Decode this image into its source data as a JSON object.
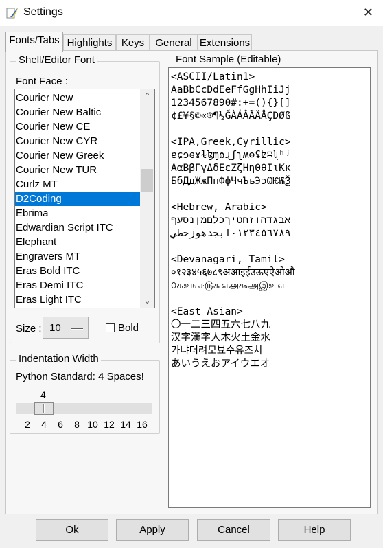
{
  "window": {
    "title": "Settings",
    "app_icon": "python-feather-icon",
    "close_glyph": "✕"
  },
  "tabs": [
    {
      "label": "Fonts/Tabs",
      "active": true
    },
    {
      "label": "Highlights",
      "active": false
    },
    {
      "label": "Keys",
      "active": false
    },
    {
      "label": "General",
      "active": false
    },
    {
      "label": "Extensions",
      "active": false
    }
  ],
  "font_panel": {
    "group_title": "Shell/Editor Font",
    "face_label": "Font Face :",
    "fonts": [
      "Courier New",
      "Courier New Baltic",
      "Courier New CE",
      "Courier New CYR",
      "Courier New Greek",
      "Courier New TUR",
      "Curlz MT",
      "D2Coding",
      "Ebrima",
      "Edwardian Script ITC",
      "Elephant",
      "Engravers MT",
      "Eras Bold ITC",
      "Eras Demi ITC",
      "Eras Light ITC"
    ],
    "selected_font": "D2Coding",
    "scroll_up_glyph": "⌃",
    "scroll_down_glyph": "⌄",
    "size_label": "Size :",
    "size_value": "10",
    "bold_label": "Bold",
    "bold_checked": false
  },
  "indentation": {
    "group_title": "Indentation Width",
    "subtitle": "Python Standard: 4 Spaces!",
    "current_value": "4",
    "ticks": [
      "2",
      "4",
      "6",
      "8",
      "10",
      "12",
      "14",
      "16"
    ]
  },
  "sample": {
    "group_title": "Font Sample (Editable)",
    "lines": [
      "<ASCII/Latin1>",
      "AaBbCcDdEeFfGgHhIiJj",
      "1234567890#:+=(){}[]",
      "¢£¥§©«®¶½ĞÀÁÂÃÄÅÇÐØß",
      "",
      "<IPA,Greek,Cyrillic>",
      "ɐɕɘɞɤɫɮɱɷɻʃʅʍʘʢʫʭʯʰʲ",
      "ΑαΒβΓγΔδΕεΖζΗηΘθΙιΚκ",
      "БбДдЖжПпФфЧчЪъЭэѠѤѬѮ",
      "",
      "<Hebrew, Arabic>",
      "אבגדהוזחטיךכלםמןנסעף",
      "٠١٢٣٤٥٦٧٨٩ابجدهوزحطي",
      "",
      "<Devanagari, Tamil>",
      "०१२३४५६७८९अआइईउऊएऐओऔ",
      "௦௧௨௩௪௫௬௭௮௯அஇஉஎ",
      "",
      "<East Asian>",
      "〇一二三四五六七八九",
      "汉字漢字人木火土金水",
      "가냐더려모뵤수유즈치",
      "あいうえおアイウエオ"
    ]
  },
  "buttons": {
    "ok": "Ok",
    "apply": "Apply",
    "cancel": "Cancel",
    "help": "Help"
  }
}
